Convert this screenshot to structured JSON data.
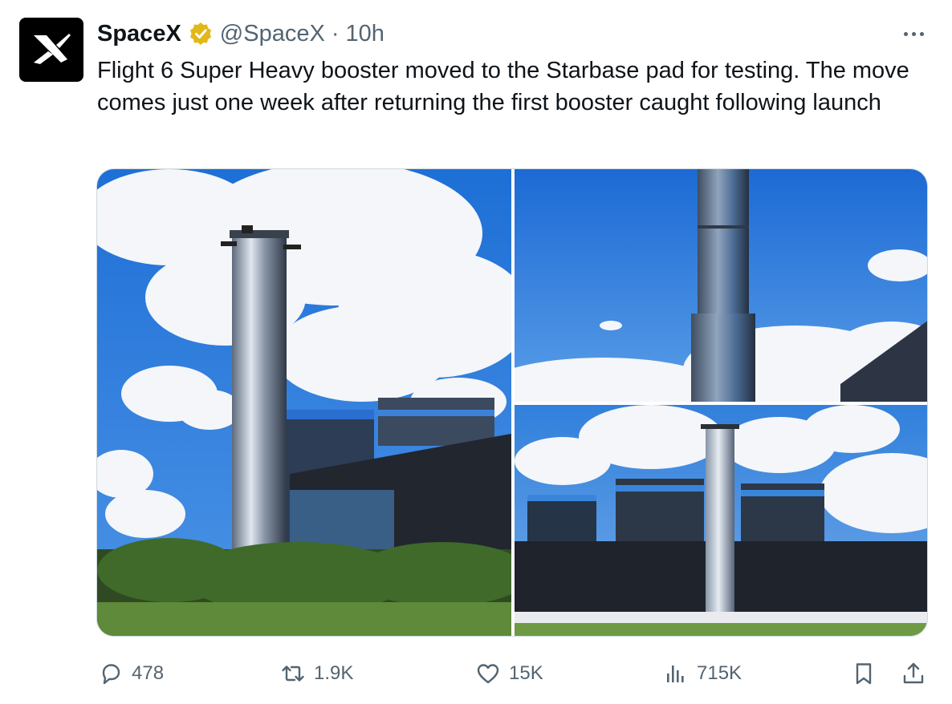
{
  "tweet": {
    "author_name": "SpaceX",
    "handle": "@SpaceX",
    "separator": "·",
    "time": "10h",
    "text": "Flight 6 Super Heavy booster moved to the Starbase pad for testing. The move comes just one week after returning the first booster caught following launch"
  },
  "icons": {
    "avatar": "spacex-x-logo",
    "verified": "verified-badge-icon",
    "more": "more-icon",
    "reply": "reply-icon",
    "retweet": "retweet-icon",
    "like": "heart-icon",
    "views": "analytics-icon",
    "bookmark": "bookmark-icon",
    "share": "share-icon"
  },
  "colors": {
    "text": "#0f1419",
    "secondary": "#536471",
    "verified_gold": "#e2b719",
    "border": "#cfd9de"
  },
  "actions": {
    "replies": "478",
    "reposts": "1.9K",
    "likes": "15K",
    "views": "715K"
  }
}
